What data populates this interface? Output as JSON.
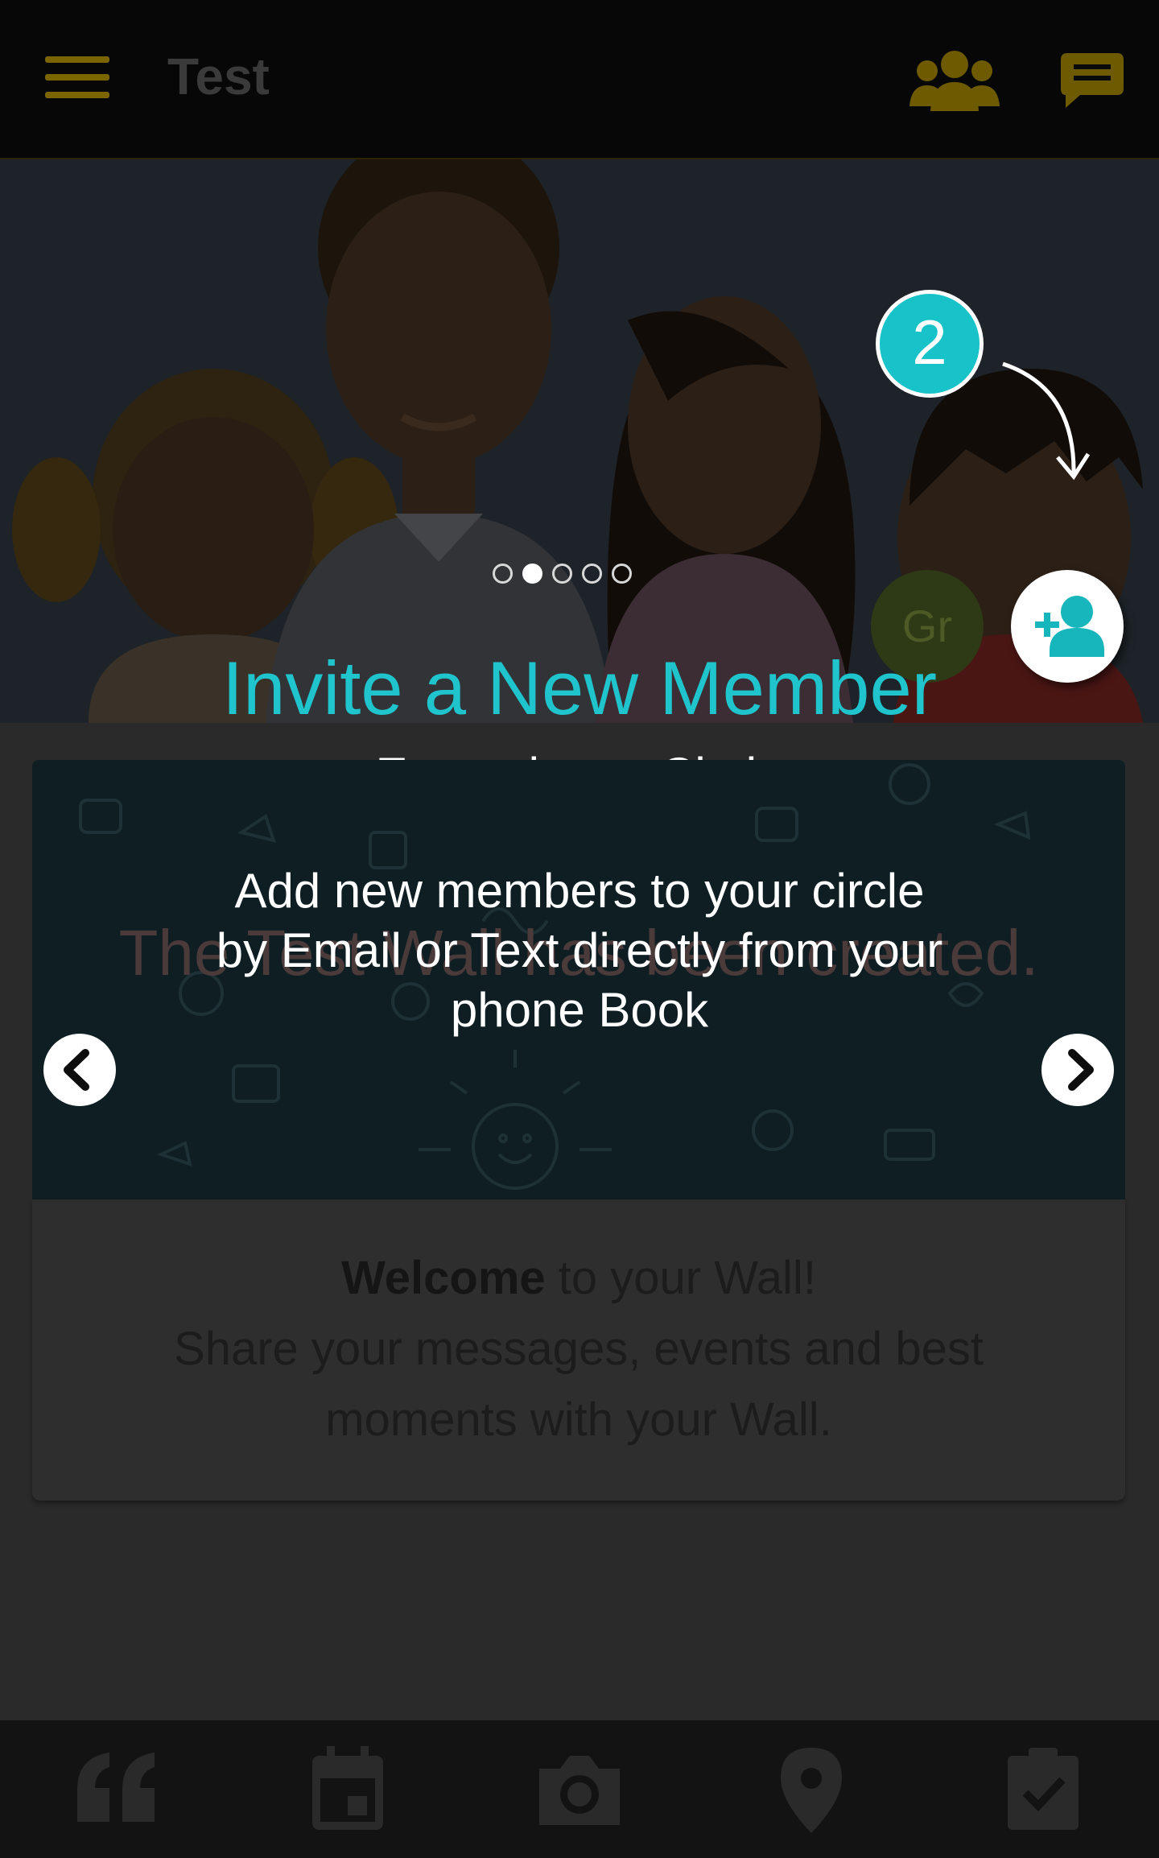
{
  "header": {
    "title": "Test",
    "menu_icon": "hamburger-icon",
    "group_icon": "group-icon",
    "chat_icon": "chat-icon"
  },
  "coach": {
    "step": "2",
    "title": "Invite a New Member",
    "subtitle": "Expand your Circle",
    "body_lines": [
      "Add new members to your circle",
      "by Email or Text directly from your",
      "phone Book"
    ],
    "page_count": 5,
    "active_page": 2,
    "accent_color": "#1fc4cc"
  },
  "avatar": {
    "initials": "Gr"
  },
  "wall": {
    "banner_text": "The Test Wall has been created.",
    "welcome_bold": "Welcome",
    "welcome_rest": " to your Wall!",
    "welcome_line2": "Share your messages, events and best",
    "welcome_line3": "moments with your Wall."
  },
  "bottom_tabs": [
    {
      "icon": "quote-icon"
    },
    {
      "icon": "calendar-icon"
    },
    {
      "icon": "camera-icon"
    },
    {
      "icon": "location-pin-icon"
    },
    {
      "icon": "checklist-icon"
    }
  ]
}
